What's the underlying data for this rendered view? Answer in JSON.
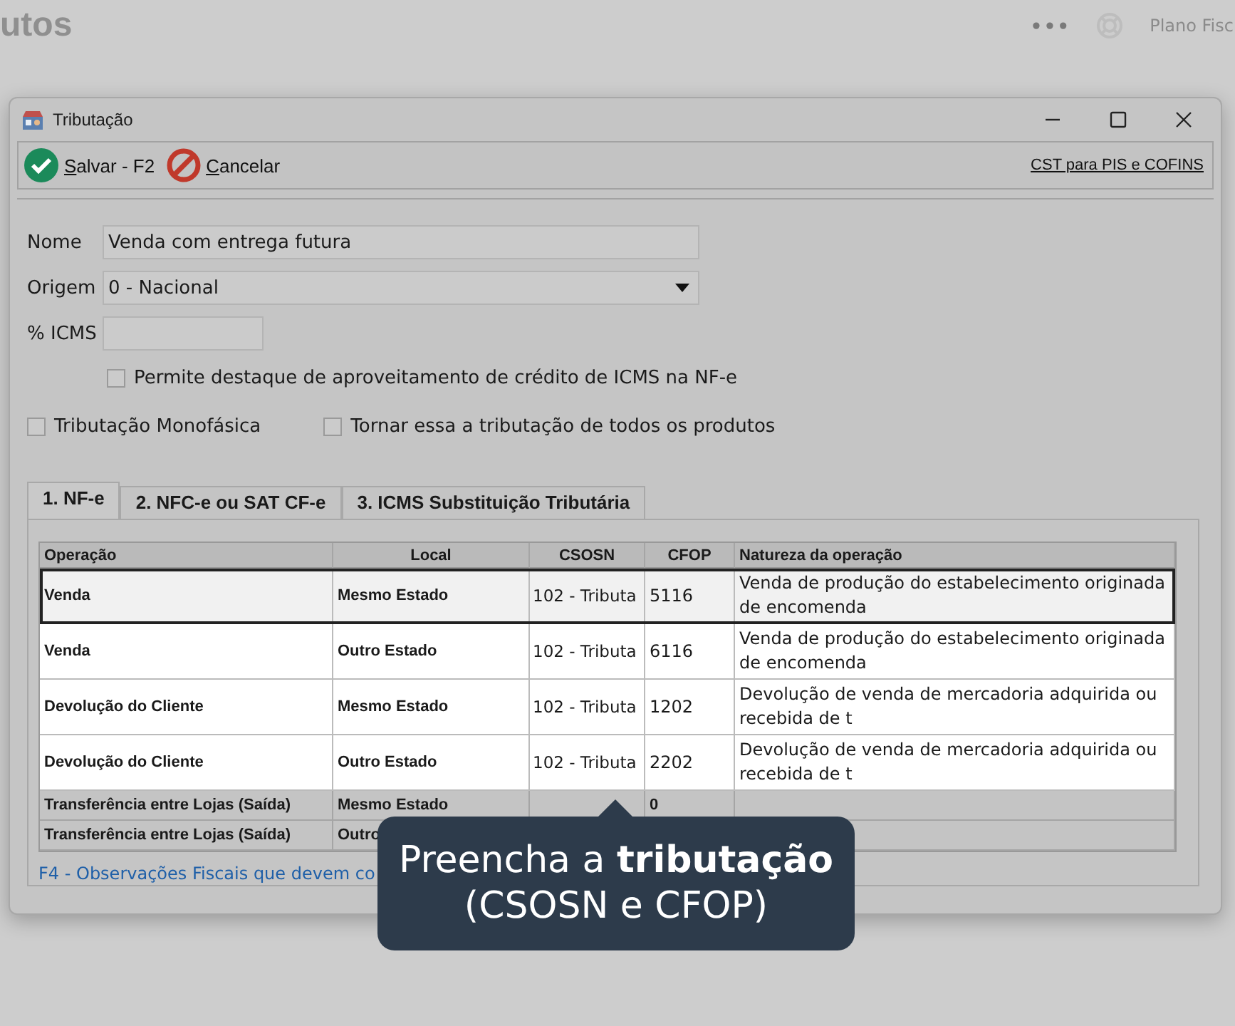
{
  "background_app": {
    "title": "utos",
    "more": "•••",
    "plan": "Plano Fisc"
  },
  "window": {
    "title": "Tributação"
  },
  "toolbar": {
    "buttons": [
      {
        "kind": "save",
        "accel": "S",
        "rest": "alvar - F2"
      },
      {
        "kind": "cancel",
        "accel": "C",
        "rest": "ancelar"
      }
    ],
    "link": "CST para PIS e COFINS"
  },
  "form": {
    "nome": {
      "label": "Nome",
      "value": "Venda com entrega futura"
    },
    "origem": {
      "label": "Origem",
      "value": "0 - Nacional"
    },
    "icms": {
      "label": "% ICMS"
    },
    "checkboxes": [
      {
        "label": "Permite destaque de aproveitamento de crédito de ICMS na NF-e",
        "checked": false
      },
      {
        "label": "Tributação Monofásica",
        "checked": false
      },
      {
        "label": "Tornar essa a tributação de todos os produtos",
        "checked": false
      }
    ]
  },
  "tabs": [
    {
      "label": "1. NF-e",
      "selected": true
    },
    {
      "label": "2. NFC-e  ou  SAT CF-e",
      "selected": false
    },
    {
      "label": "3. ICMS Substituição Tributária",
      "selected": false
    }
  ],
  "table": {
    "columns": [
      "Operação",
      "Local",
      "CSOSN",
      "CFOP",
      "Natureza da operação"
    ],
    "rows": [
      {
        "cells": [
          "Venda",
          "Mesmo Estado",
          "102 - Tributa",
          "5116",
          "Venda de produção do estabelecimento originada de encomenda"
        ],
        "selected": true,
        "highlighted": true
      },
      {
        "cells": [
          "Venda",
          "Outro Estado",
          "102 - Tributa",
          "6116",
          "Venda de produção do estabelecimento originada de encomenda"
        ],
        "selected": false,
        "highlighted": true
      },
      {
        "cells": [
          "Devolução do Cliente",
          "Mesmo Estado",
          "102 - Tributa",
          "1202",
          "Devolução de venda de mercadoria adquirida ou recebida de t"
        ],
        "selected": false,
        "highlighted": true
      },
      {
        "cells": [
          "Devolução do Cliente",
          "Outro Estado",
          "102 - Tributa",
          "2202",
          "Devolução de venda de mercadoria adquirida ou recebida de t"
        ],
        "selected": false,
        "highlighted": true
      },
      {
        "cells": [
          "Transferência entre Lojas (Saída)",
          "Mesmo Estado",
          "",
          "0",
          ""
        ],
        "selected": false,
        "highlighted": false
      },
      {
        "cells": [
          "Transferência entre Lojas (Saída)",
          "Outro",
          "",
          "",
          ""
        ],
        "selected": false,
        "highlighted": false
      }
    ]
  },
  "footer_link": "F4 - Observações Fiscais que devem co",
  "tooltip": {
    "text": "Preencha a **tributação**\n(CSOSN e CFOP)"
  }
}
